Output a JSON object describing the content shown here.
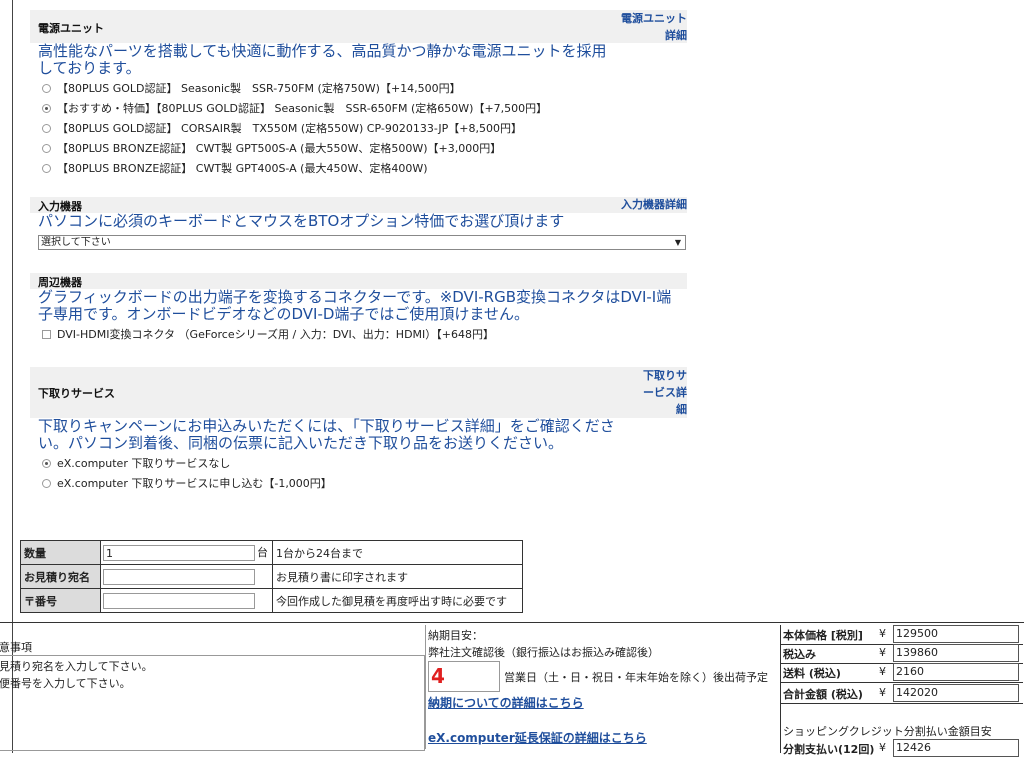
{
  "power": {
    "heading": "電源ユニット",
    "detail_link": "電源ユニット\n詳細",
    "description": "高性能なパーツを搭載しても快適に動作する、高品質かつ静かな電源ユニットを採用しております。",
    "options": [
      {
        "label": "【80PLUS GOLD認証】 Seasonic製　SSR-750FM (定格750W)【+14,500円】",
        "selected": false
      },
      {
        "label": "【おすすめ・特価】【80PLUS GOLD認証】 Seasonic製　SSR-650FM (定格650W)【+7,500円】",
        "selected": true
      },
      {
        "label": "【80PLUS GOLD認証】 CORSAIR製　TX550M (定格550W) CP-9020133-JP【+8,500円】",
        "selected": false
      },
      {
        "label": "【80PLUS BRONZE認証】 CWT製 GPT500S-A (最大550W、定格500W)【+3,000円】",
        "selected": false
      },
      {
        "label": "【80PLUS BRONZE認証】 CWT製 GPT400S-A (最大450W、定格400W)",
        "selected": false
      }
    ]
  },
  "input": {
    "heading": "入力機器",
    "detail_link": "入力機器詳細",
    "description": "パソコンに必須のキーボードとマウスをBTOオプション特価でお選び頂けます",
    "select_value": "選択して下さい"
  },
  "peripheral": {
    "heading": "周辺機器",
    "description": "グラフィックボードの出力端子を変換するコネクターです。※DVI-RGB変換コネクタはDVI-I端子専用です。オンボードビデオなどのDVI-D端子ではご使用頂けません。",
    "options": [
      {
        "label": "DVI-HDMI変換コネクタ （GeForceシリーズ用 / 入力：DVI、出力：HDMI）【+648円】",
        "checked": false
      }
    ]
  },
  "tradein": {
    "heading": "下取りサービス",
    "detail_link": "下取りサ\nービス詳\n細",
    "description": "下取りキャンペーンにお申込みいただくには、「下取りサービス詳細」をご確認ください。パソコン到着後、同梱の伝票に記入いただき下取り品をお送りください。",
    "options": [
      {
        "label": "eX.computer 下取りサービスなし",
        "selected": true
      },
      {
        "label": "eX.computer 下取りサービスに申し込む【-1,000円】",
        "selected": false
      }
    ]
  },
  "quote": {
    "rows": [
      {
        "label": "数量",
        "value": "1",
        "unit": "台",
        "note": "1台から24台まで"
      },
      {
        "label": "お見積り宛名",
        "value": "",
        "unit": "",
        "note": "お見積り書に印字されます"
      },
      {
        "label": "〒番号",
        "value": "",
        "unit": "",
        "note": "今回作成した御見積を再度呼出す時に必要です"
      }
    ]
  },
  "notes": {
    "title": "注意事項",
    "lines": [
      "お見積り宛名を入力して下さい。",
      "郵便番号を入力して下さい。"
    ]
  },
  "delivery": {
    "label": "納期目安：",
    "condition": "弊社注文確認後（銀行振込はお振込み確認後）",
    "days": "4",
    "days_suffix": "営業日（土・日・祝日・年末年始を除く）後出荷予定",
    "link1": "納期についての詳細はこちら",
    "link2": "eX.computer延長保証の詳細はこちら"
  },
  "price": {
    "yen": "¥",
    "base_label": "本体価格 [税別]",
    "base_value": "129500",
    "tax_label": "税込み",
    "tax_value": "139860",
    "ship_label": "送料 (税込)",
    "ship_value": "2160",
    "total_label": "合計金額 (税込)",
    "total_value": "142020",
    "credit_label": "ショッピングクレジット分割払い金額目安",
    "install_label": "分割支払い(12回)",
    "install_value": "12426"
  }
}
